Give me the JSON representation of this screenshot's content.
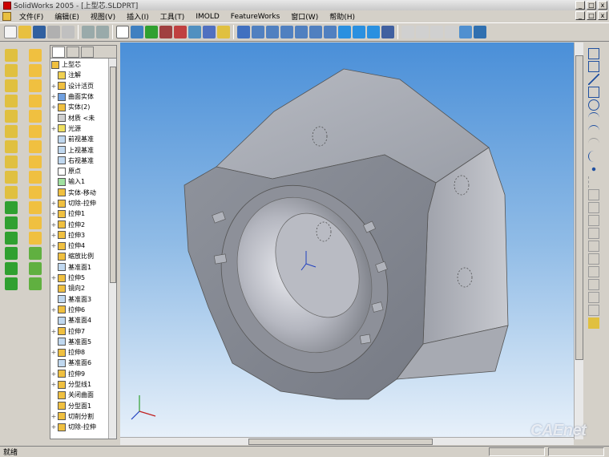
{
  "window": {
    "title": "SolidWorks 2005 - [上型芯.SLDPRT]",
    "min_label": "_",
    "max_label": "□",
    "close_label": "x"
  },
  "menu": {
    "items": [
      "文件(F)",
      "编辑(E)",
      "视图(V)",
      "插入(I)",
      "工具(T)",
      "IMOLD",
      "FeatureWorks",
      "窗口(W)",
      "帮助(H)"
    ]
  },
  "feature_tree": {
    "root": "上型芯",
    "items": [
      {
        "label": "注解",
        "exp": "",
        "color": "#f0d050"
      },
      {
        "label": "设计活页",
        "exp": "+",
        "color": "#f0c040"
      },
      {
        "label": "曲面实体",
        "exp": "+",
        "color": "#70a0e0"
      },
      {
        "label": "实体(2)",
        "exp": "+",
        "color": "#f0c040"
      },
      {
        "label": "材质 <未",
        "exp": "",
        "color": "#d0d0d0"
      },
      {
        "label": "光源",
        "exp": "+",
        "color": "#f0e060"
      },
      {
        "label": "前视基准",
        "exp": "",
        "color": "#c0d8f0"
      },
      {
        "label": "上视基准",
        "exp": "",
        "color": "#c0d8f0"
      },
      {
        "label": "右视基准",
        "exp": "",
        "color": "#c0d8f0"
      },
      {
        "label": "原点",
        "exp": "",
        "color": "#ffffff"
      },
      {
        "label": "输入1",
        "exp": "",
        "color": "#a0e0a0"
      },
      {
        "label": "实体-移动",
        "exp": "",
        "color": "#f0c040"
      },
      {
        "label": "切除-拉伸",
        "exp": "+",
        "color": "#f0c040"
      },
      {
        "label": "拉伸1",
        "exp": "+",
        "color": "#f0c040"
      },
      {
        "label": "拉伸2",
        "exp": "+",
        "color": "#f0c040"
      },
      {
        "label": "拉伸3",
        "exp": "+",
        "color": "#f0c040"
      },
      {
        "label": "拉伸4",
        "exp": "+",
        "color": "#f0c040"
      },
      {
        "label": "缩放比例",
        "exp": "",
        "color": "#f0c040"
      },
      {
        "label": "基准面1",
        "exp": "",
        "color": "#c0d8f0"
      },
      {
        "label": "拉伸5",
        "exp": "+",
        "color": "#f0c040"
      },
      {
        "label": "镜向2",
        "exp": "",
        "color": "#f0c040"
      },
      {
        "label": "基准面3",
        "exp": "",
        "color": "#c0d8f0"
      },
      {
        "label": "拉伸6",
        "exp": "+",
        "color": "#f0c040"
      },
      {
        "label": "基准面4",
        "exp": "",
        "color": "#c0d8f0"
      },
      {
        "label": "拉伸7",
        "exp": "+",
        "color": "#f0c040"
      },
      {
        "label": "基准面5",
        "exp": "",
        "color": "#c0d8f0"
      },
      {
        "label": "拉伸8",
        "exp": "+",
        "color": "#f0c040"
      },
      {
        "label": "基准面6",
        "exp": "",
        "color": "#c0d8f0"
      },
      {
        "label": "拉伸9",
        "exp": "+",
        "color": "#f0c040"
      },
      {
        "label": "分型线1",
        "exp": "+",
        "color": "#f0c040"
      },
      {
        "label": "关闭曲面",
        "exp": "",
        "color": "#f0c040"
      },
      {
        "label": "分型面1",
        "exp": "",
        "color": "#f0c040"
      },
      {
        "label": "切削分割",
        "exp": "+",
        "color": "#f0c040"
      },
      {
        "label": "切除-拉伸",
        "exp": "+",
        "color": "#f0c040"
      }
    ]
  },
  "status": {
    "text": "就绪",
    "cell1": "",
    "cell2": ""
  },
  "watermark": "CAEnet",
  "colors": {
    "viewport_top": "#4a8fd8",
    "viewport_bottom": "#e8f1fa",
    "part_fill": "#a0a4ac"
  }
}
